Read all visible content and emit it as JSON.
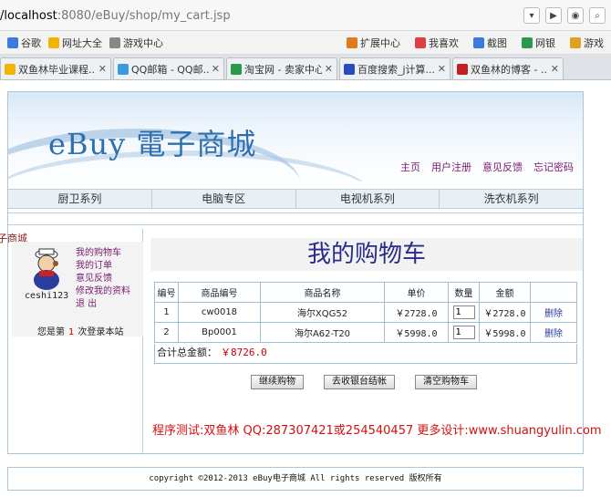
{
  "browser": {
    "url_host": "/localhost",
    "url_rest": ":8080/eBuy/shop/my_cart.jsp",
    "bookmarks": [
      {
        "label": "谷歌",
        "color": "#3b7be0"
      },
      {
        "label": "网址大全",
        "color": "#f2b400"
      },
      {
        "label": "游戏中心",
        "color": "#888888"
      }
    ],
    "bookmarks_right": [
      {
        "label": "扩展中心",
        "color": "#e07a1a"
      },
      {
        "label": "我喜欢",
        "color": "#e04040"
      },
      {
        "label": "截图",
        "color": "#3b7be0"
      },
      {
        "label": "网银",
        "color": "#2a9a4a"
      },
      {
        "label": "游戏",
        "color": "#e0a020"
      }
    ],
    "tabs": [
      {
        "label": "双鱼林毕业课程...",
        "color": "#f2b400"
      },
      {
        "label": "QQ邮箱 - QQ邮...",
        "color": "#3b9be0"
      },
      {
        "label": "淘宝网 - 卖家中心",
        "color": "#2a9a4a"
      },
      {
        "label": "百度搜索_j计算...",
        "color": "#2a4ac0"
      },
      {
        "label": "双鱼林的博客 - ...",
        "color": "#c02020"
      }
    ]
  },
  "site": {
    "logo": "eBuy 電子商城",
    "nav": [
      "主页",
      "用户注册",
      "意见反馈",
      "忘记密码"
    ],
    "categories": [
      "厨卫系列",
      "电脑专区",
      "电视机系列",
      "洗衣机系列"
    ]
  },
  "sidebar": {
    "title": "子商城",
    "username": "ceshi123",
    "links": [
      "我的购物车",
      "我的订单",
      "意见反馈",
      "修改我的资料",
      "退 出"
    ],
    "visit_prefix": "您是第",
    "visit_count": "1",
    "visit_suffix": "次登录本站"
  },
  "cart": {
    "title": "我的购物车",
    "headers": [
      "编号",
      "商品编号",
      "商品名称",
      "单价",
      "数量",
      "金额",
      ""
    ],
    "rows": [
      {
        "no": "1",
        "code": "cw0018",
        "name": "海尔XQG52",
        "price": "￥2728.0",
        "qty": "1",
        "amount": "￥2728.0",
        "action": "删除"
      },
      {
        "no": "2",
        "code": "Bp0001",
        "name": "海尔A62-T20",
        "price": "￥5998.0",
        "qty": "1",
        "amount": "￥5998.0",
        "action": "删除"
      }
    ],
    "total_label": "合计总金额：",
    "total_value": "￥8726.0",
    "buttons": [
      "继续购物",
      "去收银台结帐",
      "清空购物车"
    ],
    "promo": "程序测试:双鱼林 QQ:287307421或254540457 更多设计:www.shuangyulin.com"
  },
  "footer": "copyright ©2012-2013 eBuy电子商城 All rights reserved 版权所有"
}
